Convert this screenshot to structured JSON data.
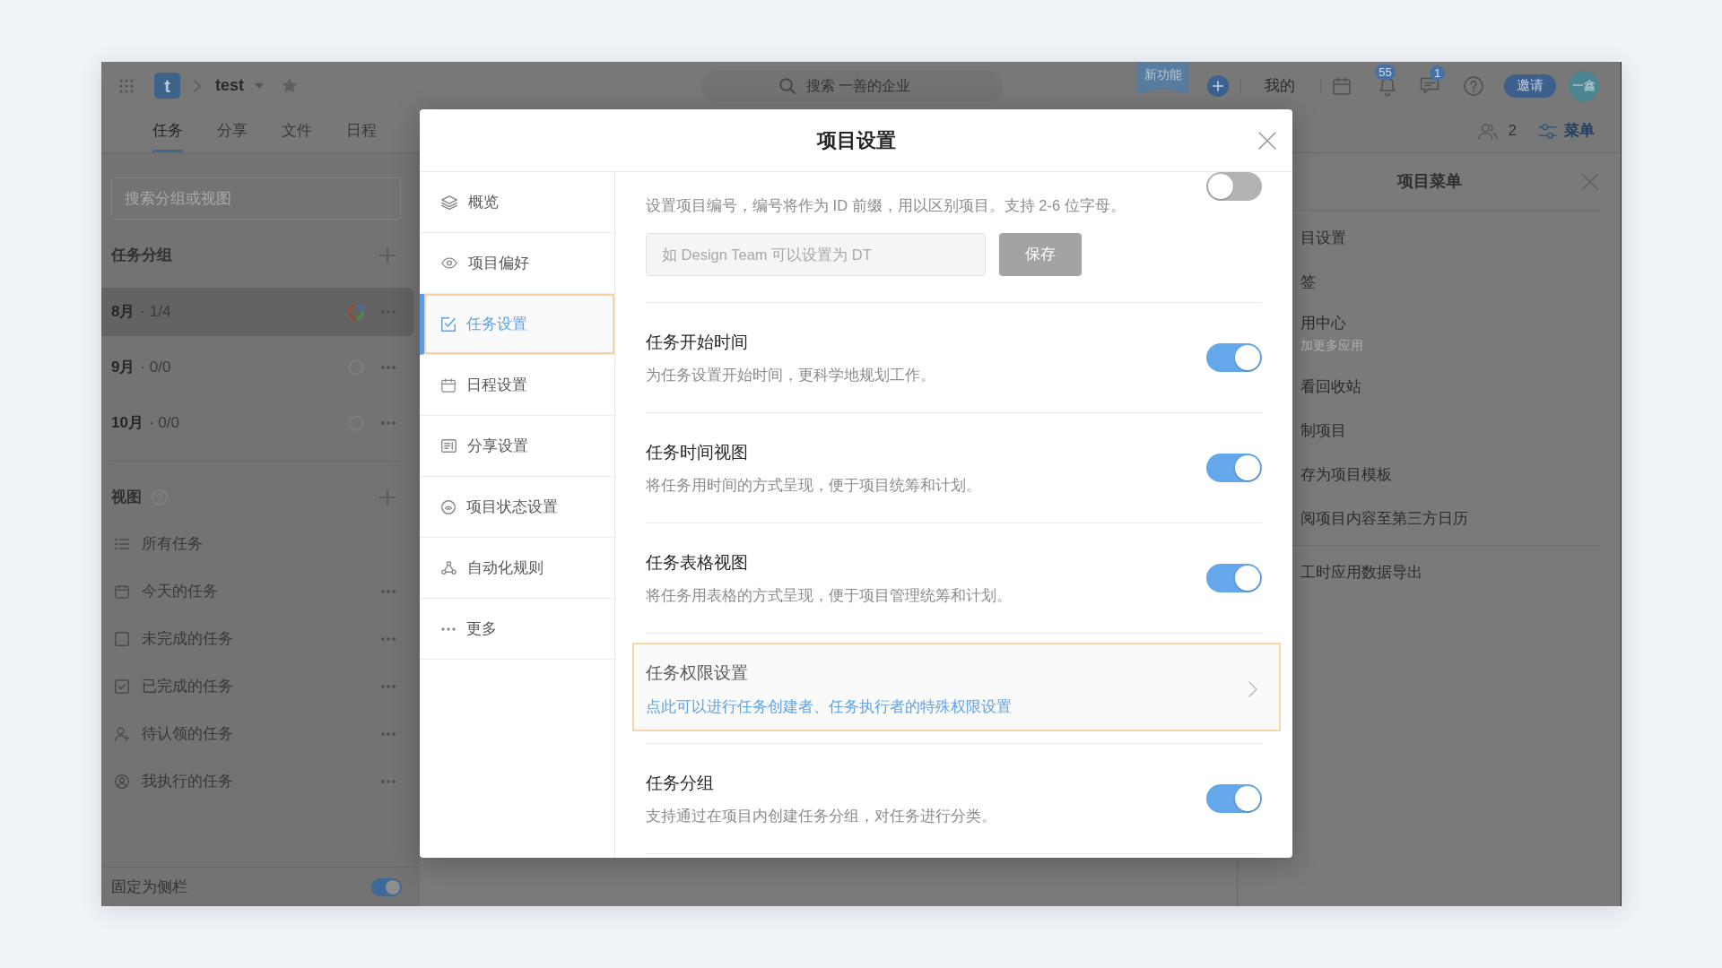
{
  "app_bar": {
    "logo_letter": "t",
    "project_name": "test",
    "search": {
      "placeholder": "搜索 一善的企业"
    },
    "ribbon": "新功能",
    "mine_link": "我的",
    "notification_count": "55",
    "message_count": "1",
    "invite_button": "邀请",
    "avatar_initials": "一鑫"
  },
  "tabs": [
    {
      "label": "任务",
      "selected": true
    },
    {
      "label": "分享",
      "selected": false
    },
    {
      "label": "文件",
      "selected": false
    },
    {
      "label": "日程",
      "selected": false
    }
  ],
  "toolbar": {
    "member_count": "2",
    "menu_button": "菜单"
  },
  "sidebar": {
    "search": {
      "placeholder": "搜索分组或视图"
    },
    "groups_heading": "任务分组",
    "groups": [
      {
        "name": "8月",
        "count": "· 1/4",
        "kind": "progress",
        "selected": true
      },
      {
        "name": "9月",
        "count": "· 0/0",
        "kind": "empty",
        "selected": false
      },
      {
        "name": "10月",
        "count": "· 0/0",
        "kind": "empty",
        "selected": false
      }
    ],
    "views_heading": "视图",
    "views": [
      {
        "label": "所有任务",
        "has_menu": false
      },
      {
        "label": "今天的任务",
        "has_menu": true
      },
      {
        "label": "未完成的任务",
        "has_menu": true
      },
      {
        "label": "已完成的任务",
        "has_menu": true
      },
      {
        "label": "待认领的任务",
        "has_menu": true
      },
      {
        "label": "我执行的任务",
        "has_menu": true
      }
    ],
    "pin": {
      "label": "固定为侧栏",
      "on": true
    }
  },
  "modal": {
    "title": "项目设置",
    "nav": [
      {
        "label": "概览",
        "selected": false
      },
      {
        "label": "项目偏好",
        "selected": false
      },
      {
        "label": "任务设置",
        "selected": true
      },
      {
        "label": "日程设置",
        "selected": false
      },
      {
        "label": "分享设置",
        "selected": false
      },
      {
        "label": "项目状态设置",
        "selected": false
      },
      {
        "label": "自动化规则",
        "selected": false
      },
      {
        "label": "更多",
        "selected": false
      }
    ],
    "settings": [
      {
        "kind": "id_prefix",
        "description": "设置项目编号，编号将作为 ID 前缀，用以区别项目。支持 2-6 位字母。",
        "input": {
          "placeholder": "如 Design Team 可以设置为 DT"
        },
        "save_button": {
          "label": "保存",
          "disabled": true
        },
        "on": false
      },
      {
        "kind": "toggle",
        "title": "任务开始时间",
        "description": "为任务设置开始时间，更科学地规划工作。",
        "on": true
      },
      {
        "kind": "toggle",
        "title": "任务时间视图",
        "description": "将任务用时间的方式呈现，便于项目统筹和计划。",
        "on": true
      },
      {
        "kind": "toggle",
        "title": "任务表格视图",
        "description": "将任务用表格的方式呈现，便于项目管理统筹和计划。",
        "on": true
      },
      {
        "kind": "link",
        "title": "任务权限设置",
        "description": "点此可以进行任务创建者、任务执行者的特殊权限设置"
      },
      {
        "kind": "toggle",
        "title": "任务分组",
        "description": "支持通过在项目内创建任务分组，对任务进行分类。",
        "on": true
      }
    ]
  },
  "project_menu": {
    "title": "项目菜单",
    "items": [
      {
        "label": "目设置"
      },
      {
        "label": "签"
      },
      {
        "label": "用中心",
        "subtitle": "加更多应用"
      },
      {
        "label": "看回收站"
      },
      {
        "label": "制项目"
      },
      {
        "label": "存为项目模板"
      },
      {
        "label": "阅项目内容至第三方日历"
      }
    ],
    "extra_items": [
      {
        "label": "工时应用数据导出"
      }
    ]
  }
}
